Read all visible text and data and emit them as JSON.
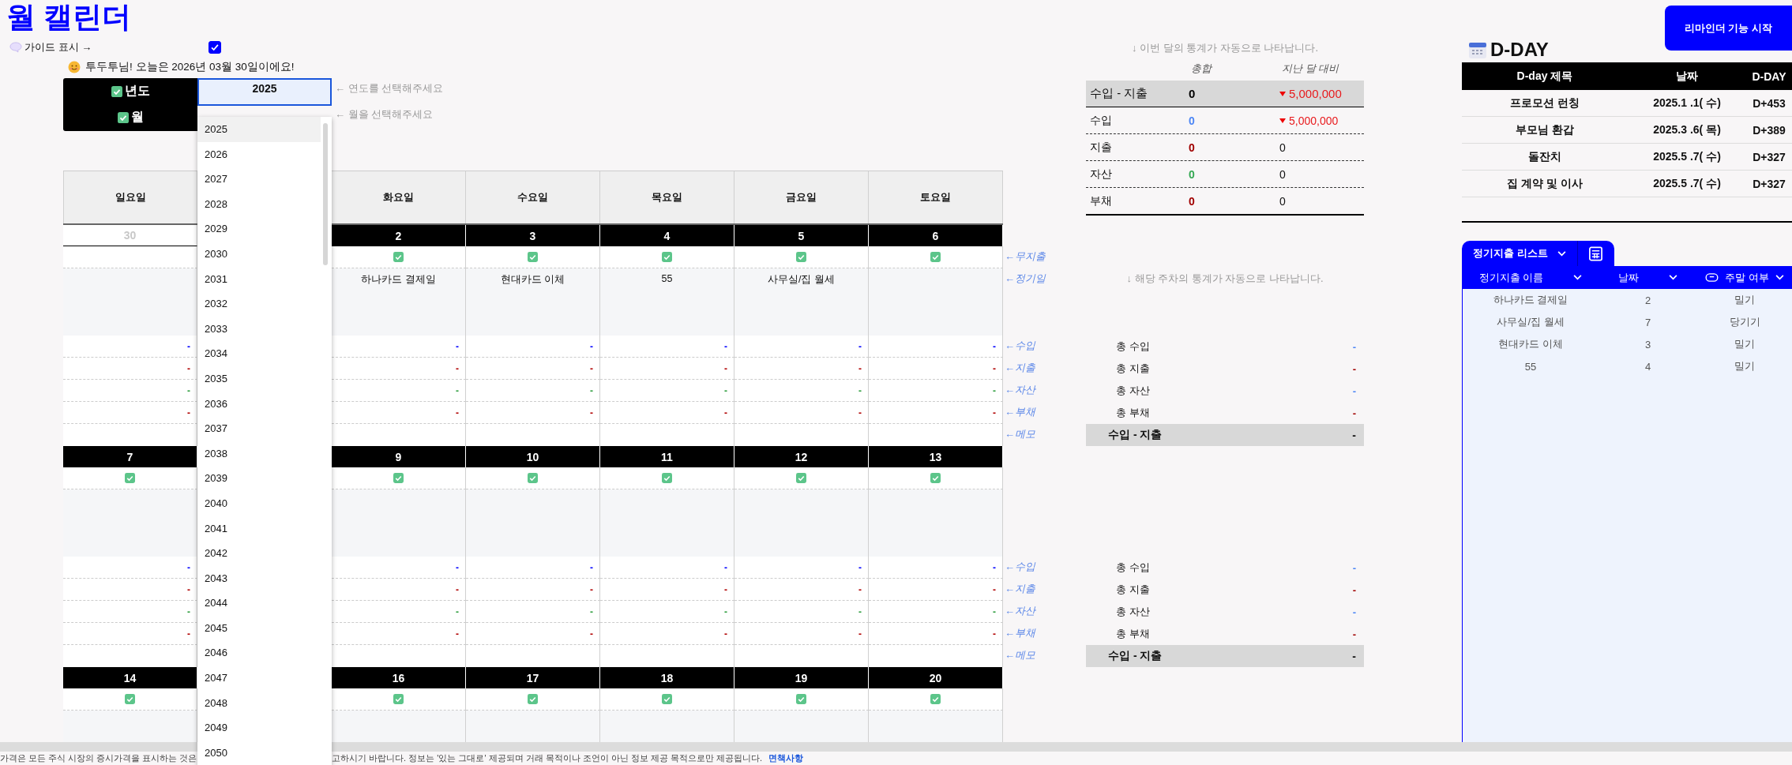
{
  "title": "월 캘린더",
  "guide": {
    "label": "가이드 표시 →",
    "checked": true
  },
  "greeting": "투두투님! 오늘은 2026년 03월 30일이에요!",
  "selector": {
    "year_label": "년도",
    "month_label": "월",
    "year_value": "2025",
    "year_hint": "← 연도를 선택해주세요",
    "month_hint": "← 월을 선택해주세요"
  },
  "year_dropdown": [
    {
      "label": "2025",
      "selected": true
    },
    {
      "label": "2026",
      "selected": false
    },
    {
      "label": "2027",
      "selected": false
    },
    {
      "label": "2028",
      "selected": false
    },
    {
      "label": "2029",
      "selected": false
    },
    {
      "label": "2030",
      "selected": false
    },
    {
      "label": "2031",
      "selected": false
    },
    {
      "label": "2032",
      "selected": false
    },
    {
      "label": "2033",
      "selected": false
    },
    {
      "label": "2034",
      "selected": false
    },
    {
      "label": "2035",
      "selected": false
    },
    {
      "label": "2036",
      "selected": false
    },
    {
      "label": "2037",
      "selected": false
    },
    {
      "label": "2038",
      "selected": false
    },
    {
      "label": "2039",
      "selected": false
    },
    {
      "label": "2040",
      "selected": false
    },
    {
      "label": "2041",
      "selected": false
    },
    {
      "label": "2042",
      "selected": false
    },
    {
      "label": "2043",
      "selected": false
    },
    {
      "label": "2044",
      "selected": false
    },
    {
      "label": "2045",
      "selected": false
    },
    {
      "label": "2046",
      "selected": false
    },
    {
      "label": "2047",
      "selected": false
    },
    {
      "label": "2048",
      "selected": false
    },
    {
      "label": "2049",
      "selected": false
    },
    {
      "label": "2050",
      "selected": false
    }
  ],
  "weekdays": [
    {
      "label": "일요일"
    },
    {
      "label": "화요일"
    },
    {
      "label": "수요일"
    },
    {
      "label": "목요일"
    },
    {
      "label": "금요일"
    },
    {
      "label": "토요일"
    }
  ],
  "weeks": [
    {
      "rows": [
        {
          "kind": "check",
          "label": "←무지출"
        },
        {
          "kind": "event",
          "label": "←정기일",
          "note": "↓ 해당 주차의 통계가 자동으로 나타납니다."
        },
        {
          "kind": "income",
          "label": "←수입",
          "summary": {
            "label": "총 수입",
            "value": "-"
          }
        },
        {
          "kind": "expense",
          "label": "←지출",
          "summary": {
            "label": "총 지출",
            "value": "-"
          }
        },
        {
          "kind": "asset",
          "label": "←자산",
          "summary": {
            "label": "총 자산",
            "value": "-"
          }
        },
        {
          "kind": "debt",
          "label": "←부채",
          "summary": {
            "label": "총 부채",
            "value": "-"
          }
        },
        {
          "kind": "memo",
          "label": "←메모",
          "summary": {
            "label": "수입 - 지출",
            "value": "-"
          }
        }
      ],
      "days": [
        {
          "date": "30",
          "in_month": false,
          "checked": false,
          "income": "-",
          "expense": "-",
          "asset": "-",
          "debt": "-"
        },
        {
          "date": "2",
          "in_month": true,
          "checked": true,
          "event": "하나카드 결제일",
          "income": "-",
          "expense": "-",
          "asset": "-",
          "debt": "-"
        },
        {
          "date": "3",
          "in_month": true,
          "checked": true,
          "event": "현대카드 이체",
          "income": "-",
          "expense": "-",
          "asset": "-",
          "debt": "-"
        },
        {
          "date": "4",
          "in_month": true,
          "checked": true,
          "event": "55",
          "income": "-",
          "expense": "-",
          "asset": "-",
          "debt": "-"
        },
        {
          "date": "5",
          "in_month": true,
          "checked": true,
          "event": "사무실/집 월세",
          "income": "-",
          "expense": "-",
          "asset": "-",
          "debt": "-"
        },
        {
          "date": "6",
          "in_month": true,
          "checked": true,
          "income": "-",
          "expense": "-",
          "asset": "-",
          "debt": "-"
        }
      ]
    },
    {
      "rows": [
        {
          "kind": "check"
        },
        {
          "kind": "event"
        },
        {
          "kind": "income",
          "label": "←수입",
          "summary": {
            "label": "총 수입",
            "value": "-"
          }
        },
        {
          "kind": "expense",
          "label": "←지출",
          "summary": {
            "label": "총 지출",
            "value": "-"
          }
        },
        {
          "kind": "asset",
          "label": "←자산",
          "summary": {
            "label": "총 자산",
            "value": "-"
          }
        },
        {
          "kind": "debt",
          "label": "←부채",
          "summary": {
            "label": "총 부채",
            "value": "-"
          }
        },
        {
          "kind": "memo",
          "label": "←메모",
          "summary": {
            "label": "수입 - 지출",
            "value": "-"
          }
        }
      ],
      "days": [
        {
          "date": "7",
          "in_month": true,
          "checked": true,
          "income": "-",
          "expense": "-",
          "asset": "-",
          "debt": "-"
        },
        {
          "date": "9",
          "in_month": true,
          "checked": true,
          "income": "-",
          "expense": "-",
          "asset": "-",
          "debt": "-"
        },
        {
          "date": "10",
          "in_month": true,
          "checked": true,
          "income": "-",
          "expense": "-",
          "asset": "-",
          "debt": "-"
        },
        {
          "date": "11",
          "in_month": true,
          "checked": true,
          "income": "-",
          "expense": "-",
          "asset": "-",
          "debt": "-"
        },
        {
          "date": "12",
          "in_month": true,
          "checked": true,
          "income": "-",
          "expense": "-",
          "asset": "-",
          "debt": "-"
        },
        {
          "date": "13",
          "in_month": true,
          "checked": true,
          "income": "-",
          "expense": "-",
          "asset": "-",
          "debt": "-"
        }
      ]
    },
    {
      "rows": [
        {
          "kind": "check"
        },
        {
          "kind": "event"
        }
      ],
      "days": [
        {
          "date": "14",
          "in_month": true,
          "checked": true
        },
        {
          "date": "16",
          "in_month": true,
          "checked": true
        },
        {
          "date": "17",
          "in_month": true,
          "checked": true
        },
        {
          "date": "18",
          "in_month": true,
          "checked": true
        },
        {
          "date": "19",
          "in_month": true,
          "checked": true
        },
        {
          "date": "20",
          "in_month": true,
          "checked": true
        }
      ]
    }
  ],
  "month_stats": {
    "hint": "↓ 이번 달의 통계가 자동으로 나타납니다.",
    "columns": [
      "총합",
      "지난 달 대비"
    ],
    "rows": [
      {
        "kind": "net",
        "label": "수입 - 지출",
        "total": "0",
        "change": "5,000,000",
        "down": true
      },
      {
        "kind": "income",
        "label": "수입",
        "total": "0",
        "change": "5,000,000",
        "down": true
      },
      {
        "kind": "expense",
        "label": "지출",
        "total": "0",
        "change": "0",
        "down": false
      },
      {
        "kind": "asset",
        "label": "자산",
        "total": "0",
        "change": "0",
        "down": false
      },
      {
        "kind": "debt",
        "label": "부채",
        "total": "0",
        "change": "0",
        "down": false
      }
    ]
  },
  "reminder_button": "리마인더 기능 시작",
  "dday": {
    "title": "D-DAY",
    "columns": [
      "D-day 제목",
      "날짜",
      "D-DAY"
    ],
    "rows": [
      {
        "title": "프로모션 런칭",
        "date": "2025.1 .1( 수)",
        "dday": "D+453"
      },
      {
        "title": "부모님 환갑",
        "date": "2025.3 .6( 목)",
        "dday": "D+389"
      },
      {
        "title": "돌잔치",
        "date": "2025.5 .7( 수)",
        "dday": "D+327"
      },
      {
        "title": "집 계약 및 이사",
        "date": "2025.5 .7( 수)",
        "dday": "D+327"
      }
    ]
  },
  "regular_expenses": {
    "tab": "정기지출 리스트",
    "columns": [
      {
        "label": "정기지출 이름",
        "kind": "text"
      },
      {
        "label": "날짜",
        "kind": "text"
      },
      {
        "label": "주말 여부",
        "kind": "option"
      }
    ],
    "rows": [
      [
        "하나카드 결제일",
        "2",
        "밀기"
      ],
      [
        "사무실/집 월세",
        "7",
        "당기기"
      ],
      [
        "현대카드 이체",
        "3",
        "밀기"
      ],
      [
        "55",
        "4",
        "밀기"
      ]
    ]
  },
  "footer": {
    "text_before": "가격은 모든 주식 시장의 증시가격을 표시하는 것은",
    "text_after": "고하시기 바랍니다. 정보는 '있는 그대로' 제공되며 거래 목적이나 조언이 아닌 정보 제공 목적으로만 제공됩니다.",
    "link": "면책사항"
  }
}
